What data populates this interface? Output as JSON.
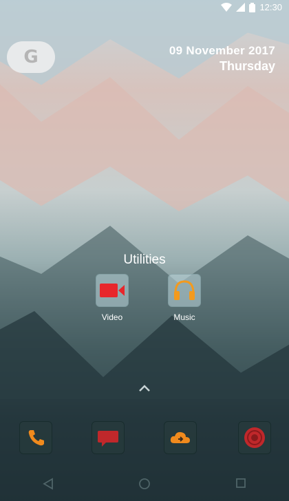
{
  "status_bar": {
    "time": "12:30",
    "icons": [
      "wifi-icon",
      "signal-icon",
      "battery-icon"
    ]
  },
  "search_widget": {
    "logo": "G"
  },
  "clock_widget": {
    "date": "09 November 2017",
    "day": "Thursday"
  },
  "folder": {
    "title": "Utilities",
    "apps": [
      {
        "label": "Video",
        "icon": "video-camera-icon",
        "color": "#e8262b"
      },
      {
        "label": "Music",
        "icon": "headphones-icon",
        "color": "#f39a1e"
      }
    ]
  },
  "dock": {
    "apps": [
      "phone-icon",
      "messages-icon",
      "cloud-sync-icon",
      "camera-icon"
    ]
  },
  "nav_bar": {
    "buttons": [
      "back-button",
      "home-button",
      "recents-button"
    ]
  }
}
